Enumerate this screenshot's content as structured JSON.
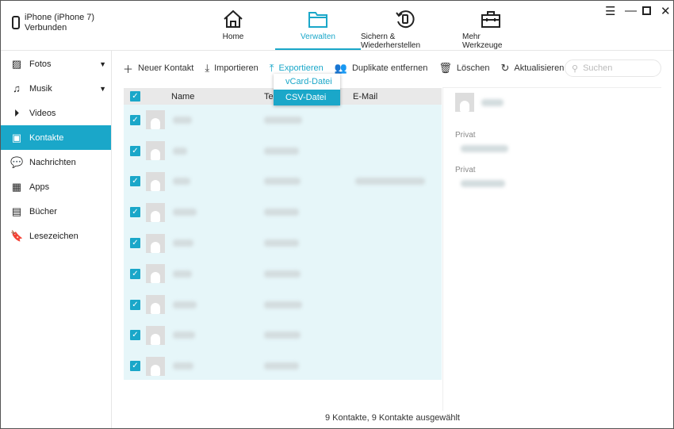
{
  "device": {
    "name": "iPhone (iPhone 7)",
    "status": "Verbunden"
  },
  "nav": [
    {
      "label": "Home",
      "icon": "home-icon"
    },
    {
      "label": "Verwalten",
      "icon": "folder-icon",
      "active": true
    },
    {
      "label": "Sichern & Wiederherstellen",
      "icon": "backup-restore-icon"
    },
    {
      "label": "Mehr Werkzeuge",
      "icon": "toolbox-icon"
    }
  ],
  "window_controls": [
    "menu-icon",
    "minimize-icon",
    "maximize-icon",
    "close-icon"
  ],
  "sidebar": [
    {
      "label": "Fotos",
      "icon": "photo-icon",
      "chevron": true
    },
    {
      "label": "Musik",
      "icon": "music-icon",
      "chevron": true
    },
    {
      "label": "Videos",
      "icon": "play-icon"
    },
    {
      "label": "Kontakte",
      "icon": "contact-icon",
      "active": true
    },
    {
      "label": "Nachrichten",
      "icon": "message-icon"
    },
    {
      "label": "Apps",
      "icon": "apps-icon"
    },
    {
      "label": "Bücher",
      "icon": "book-icon"
    },
    {
      "label": "Lesezeichen",
      "icon": "bookmark-icon"
    }
  ],
  "toolbar": {
    "new": "Neuer Kontakt",
    "import": "Importieren",
    "export": "Exportieren",
    "dedupe": "Duplikate entfernen",
    "delete": "Löschen",
    "refresh": "Aktualisieren",
    "search_placeholder": "Suchen"
  },
  "export_menu": {
    "items": [
      "vCard-Datei",
      "CSV-Datei"
    ],
    "selected": "CSV-Datei"
  },
  "table": {
    "columns": [
      "Name",
      "Te",
      "E-Mail"
    ],
    "row_count": 9,
    "all_checked": true
  },
  "detail": {
    "labels": [
      "Privat",
      "Privat"
    ]
  },
  "accent": "#1aa7c9",
  "status": "9 Kontakte, 9 Kontakte ausgewählt"
}
